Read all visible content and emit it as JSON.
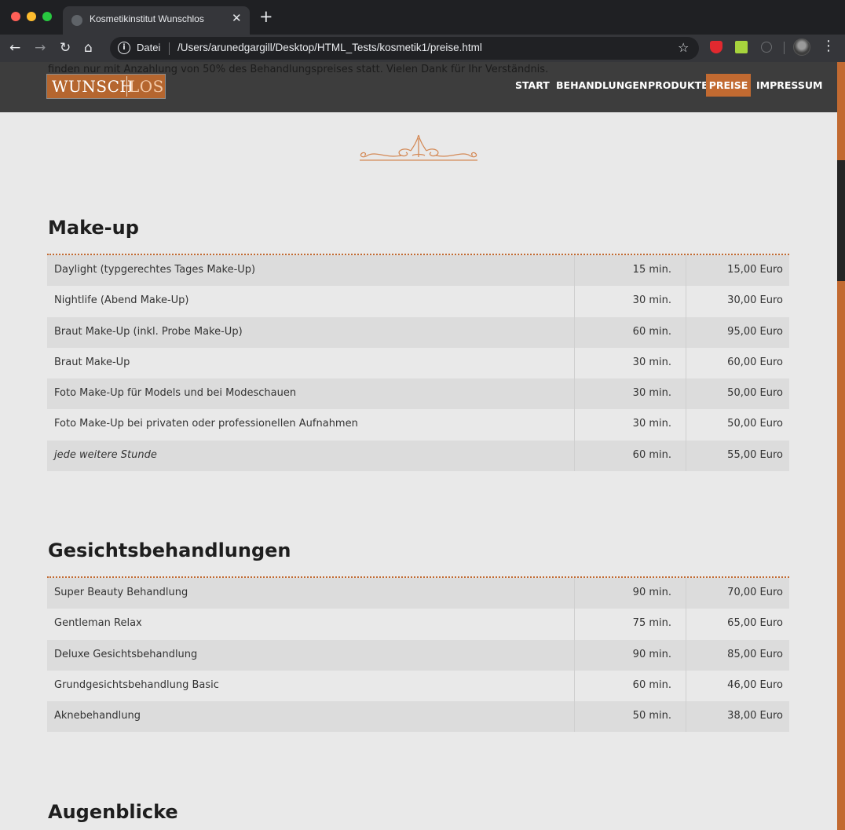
{
  "browser": {
    "tab_title": "Kosmetikinstitut Wunschlos",
    "address_scheme": "Datei",
    "address_url": "/Users/arunedgargill/Desktop/HTML_Tests/kosmetik1/preise.html"
  },
  "site": {
    "bleed_text": "finden nur mit Anzahlung von 50% des Behandlungspreises statt. Vielen Dank für Ihr Verständnis.",
    "logo": {
      "part1": "WUNSCH",
      "part2": "LOS"
    },
    "nav": [
      {
        "label": "START",
        "active": false
      },
      {
        "label": "BEHANDLUNGEN",
        "active": false
      },
      {
        "label": "PRODUKTE",
        "active": false
      },
      {
        "label": "PREISE",
        "active": true
      },
      {
        "label": "IMPRESSUM",
        "active": false
      }
    ],
    "accent_color": "#c26a31"
  },
  "sections": [
    {
      "title": "Make-up",
      "rows": [
        {
          "name": "Daylight (typgerechtes Tages Make-Up)",
          "time": "15 min.",
          "price": "15,00 Euro"
        },
        {
          "name": "Nightlife (Abend Make-Up)",
          "time": "30 min.",
          "price": "30,00 Euro"
        },
        {
          "name": "Braut Make-Up (inkl. Probe Make-Up)",
          "time": "60 min.",
          "price": "95,00 Euro"
        },
        {
          "name": "Braut Make-Up",
          "time": "30 min.",
          "price": "60,00 Euro"
        },
        {
          "name": "Foto Make-Up für Models und bei Modeschauen",
          "time": "30 min.",
          "price": "50,00 Euro"
        },
        {
          "name": "Foto Make-Up bei privaten oder professionellen Aufnahmen",
          "time": "30 min.",
          "price": "50,00 Euro"
        },
        {
          "name": "jede weitere Stunde",
          "time": "60 min.",
          "price": "55,00 Euro",
          "italic": true
        }
      ]
    },
    {
      "title": "Gesichtsbehandlungen",
      "rows": [
        {
          "name": "Super Beauty Behandlung",
          "time": "90 min.",
          "price": "70,00 Euro"
        },
        {
          "name": "Gentleman Relax",
          "time": "75 min.",
          "price": "65,00 Euro"
        },
        {
          "name": "Deluxe Gesichtsbehandlung",
          "time": "90 min.",
          "price": "85,00 Euro"
        },
        {
          "name": "Grundgesichtsbehandlung Basic",
          "time": "60 min.",
          "price": "46,00 Euro"
        },
        {
          "name": "Aknebehandlung",
          "time": "50 min.",
          "price": "38,00 Euro"
        }
      ]
    },
    {
      "title": "Augenblicke",
      "rows": []
    }
  ]
}
